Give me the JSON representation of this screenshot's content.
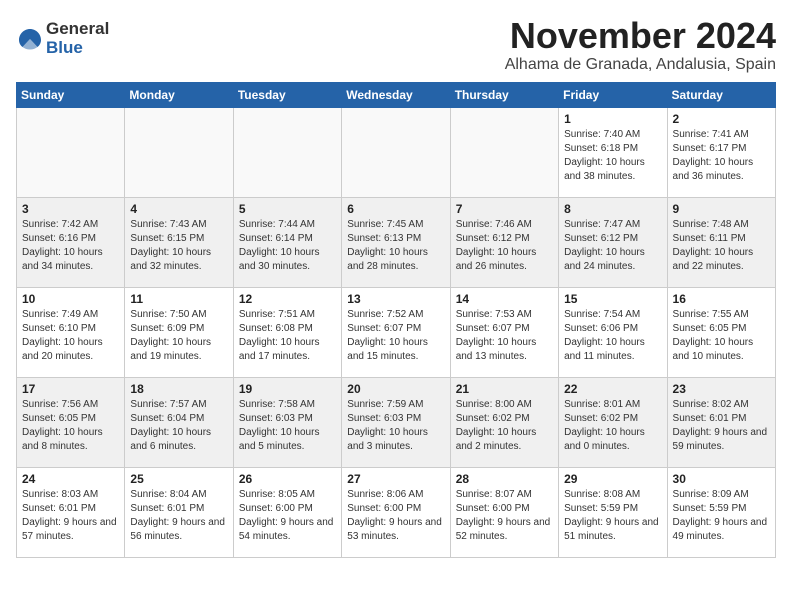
{
  "logo": {
    "general": "General",
    "blue": "Blue"
  },
  "title": {
    "month_year": "November 2024",
    "location": "Alhama de Granada, Andalusia, Spain"
  },
  "headers": [
    "Sunday",
    "Monday",
    "Tuesday",
    "Wednesday",
    "Thursday",
    "Friday",
    "Saturday"
  ],
  "rows": [
    [
      {
        "day": "",
        "empty": true
      },
      {
        "day": "",
        "empty": true
      },
      {
        "day": "",
        "empty": true
      },
      {
        "day": "",
        "empty": true
      },
      {
        "day": "",
        "empty": true
      },
      {
        "day": "1",
        "info": "Sunrise: 7:40 AM\nSunset: 6:18 PM\nDaylight: 10 hours and 38 minutes."
      },
      {
        "day": "2",
        "info": "Sunrise: 7:41 AM\nSunset: 6:17 PM\nDaylight: 10 hours and 36 minutes."
      }
    ],
    [
      {
        "day": "3",
        "info": "Sunrise: 7:42 AM\nSunset: 6:16 PM\nDaylight: 10 hours and 34 minutes."
      },
      {
        "day": "4",
        "info": "Sunrise: 7:43 AM\nSunset: 6:15 PM\nDaylight: 10 hours and 32 minutes."
      },
      {
        "day": "5",
        "info": "Sunrise: 7:44 AM\nSunset: 6:14 PM\nDaylight: 10 hours and 30 minutes."
      },
      {
        "day": "6",
        "info": "Sunrise: 7:45 AM\nSunset: 6:13 PM\nDaylight: 10 hours and 28 minutes."
      },
      {
        "day": "7",
        "info": "Sunrise: 7:46 AM\nSunset: 6:12 PM\nDaylight: 10 hours and 26 minutes."
      },
      {
        "day": "8",
        "info": "Sunrise: 7:47 AM\nSunset: 6:12 PM\nDaylight: 10 hours and 24 minutes."
      },
      {
        "day": "9",
        "info": "Sunrise: 7:48 AM\nSunset: 6:11 PM\nDaylight: 10 hours and 22 minutes."
      }
    ],
    [
      {
        "day": "10",
        "info": "Sunrise: 7:49 AM\nSunset: 6:10 PM\nDaylight: 10 hours and 20 minutes."
      },
      {
        "day": "11",
        "info": "Sunrise: 7:50 AM\nSunset: 6:09 PM\nDaylight: 10 hours and 19 minutes."
      },
      {
        "day": "12",
        "info": "Sunrise: 7:51 AM\nSunset: 6:08 PM\nDaylight: 10 hours and 17 minutes."
      },
      {
        "day": "13",
        "info": "Sunrise: 7:52 AM\nSunset: 6:07 PM\nDaylight: 10 hours and 15 minutes."
      },
      {
        "day": "14",
        "info": "Sunrise: 7:53 AM\nSunset: 6:07 PM\nDaylight: 10 hours and 13 minutes."
      },
      {
        "day": "15",
        "info": "Sunrise: 7:54 AM\nSunset: 6:06 PM\nDaylight: 10 hours and 11 minutes."
      },
      {
        "day": "16",
        "info": "Sunrise: 7:55 AM\nSunset: 6:05 PM\nDaylight: 10 hours and 10 minutes."
      }
    ],
    [
      {
        "day": "17",
        "info": "Sunrise: 7:56 AM\nSunset: 6:05 PM\nDaylight: 10 hours and 8 minutes."
      },
      {
        "day": "18",
        "info": "Sunrise: 7:57 AM\nSunset: 6:04 PM\nDaylight: 10 hours and 6 minutes."
      },
      {
        "day": "19",
        "info": "Sunrise: 7:58 AM\nSunset: 6:03 PM\nDaylight: 10 hours and 5 minutes."
      },
      {
        "day": "20",
        "info": "Sunrise: 7:59 AM\nSunset: 6:03 PM\nDaylight: 10 hours and 3 minutes."
      },
      {
        "day": "21",
        "info": "Sunrise: 8:00 AM\nSunset: 6:02 PM\nDaylight: 10 hours and 2 minutes."
      },
      {
        "day": "22",
        "info": "Sunrise: 8:01 AM\nSunset: 6:02 PM\nDaylight: 10 hours and 0 minutes."
      },
      {
        "day": "23",
        "info": "Sunrise: 8:02 AM\nSunset: 6:01 PM\nDaylight: 9 hours and 59 minutes."
      }
    ],
    [
      {
        "day": "24",
        "info": "Sunrise: 8:03 AM\nSunset: 6:01 PM\nDaylight: 9 hours and 57 minutes."
      },
      {
        "day": "25",
        "info": "Sunrise: 8:04 AM\nSunset: 6:01 PM\nDaylight: 9 hours and 56 minutes."
      },
      {
        "day": "26",
        "info": "Sunrise: 8:05 AM\nSunset: 6:00 PM\nDaylight: 9 hours and 54 minutes."
      },
      {
        "day": "27",
        "info": "Sunrise: 8:06 AM\nSunset: 6:00 PM\nDaylight: 9 hours and 53 minutes."
      },
      {
        "day": "28",
        "info": "Sunrise: 8:07 AM\nSunset: 6:00 PM\nDaylight: 9 hours and 52 minutes."
      },
      {
        "day": "29",
        "info": "Sunrise: 8:08 AM\nSunset: 5:59 PM\nDaylight: 9 hours and 51 minutes."
      },
      {
        "day": "30",
        "info": "Sunrise: 8:09 AM\nSunset: 5:59 PM\nDaylight: 9 hours and 49 minutes."
      }
    ]
  ],
  "shaded_rows": [
    1,
    3
  ]
}
